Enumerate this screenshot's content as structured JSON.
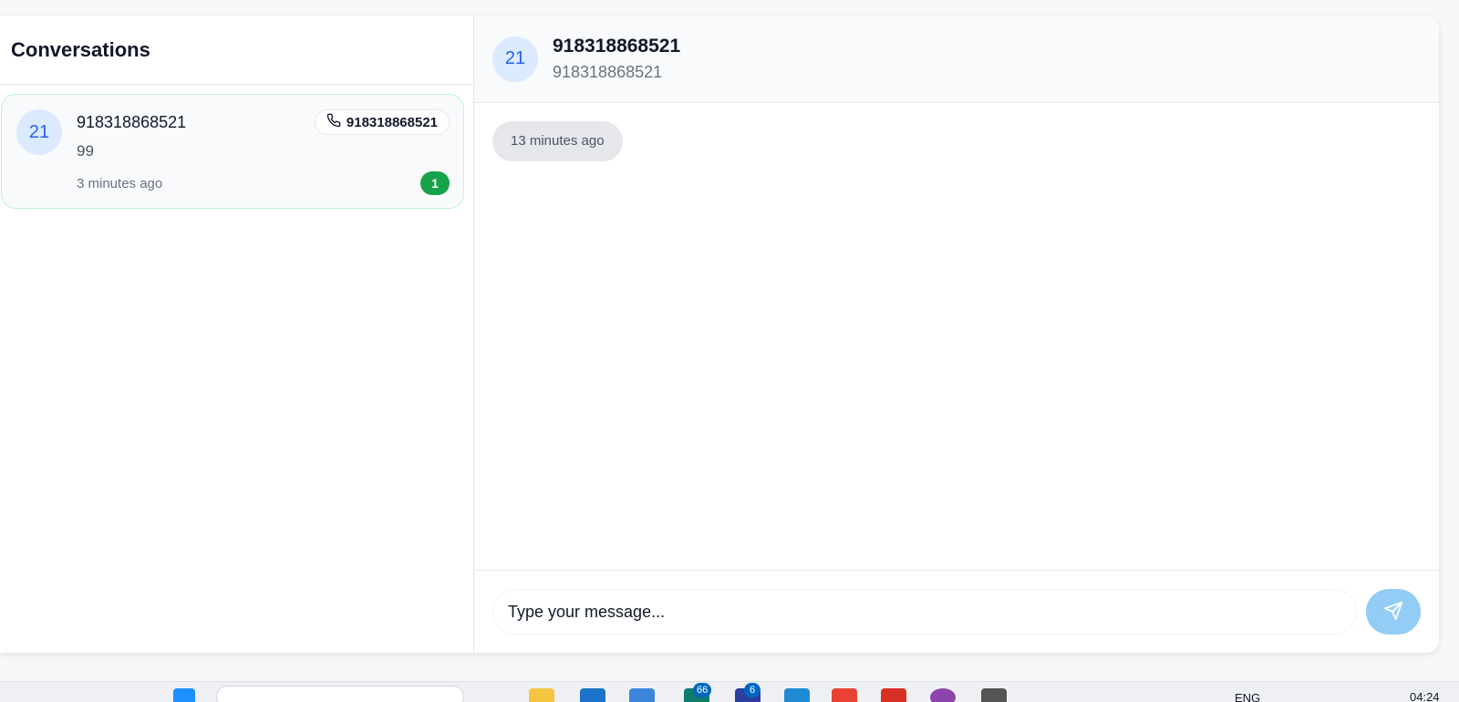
{
  "sidebar": {
    "title": "Conversations",
    "conversations": [
      {
        "avatar_text": "21",
        "name": "918318868521",
        "preview": "99",
        "time": "3 minutes ago",
        "phone": "918318868521",
        "unread_count": "1"
      }
    ]
  },
  "chat": {
    "avatar_text": "21",
    "title": "918318868521",
    "subtitle": "918318868521",
    "messages": [
      {
        "time": "13 minutes ago"
      }
    ],
    "composer": {
      "placeholder": "Type your message...",
      "send_icon": "send-icon"
    }
  },
  "taskbar": {
    "badges": [
      "66",
      "6"
    ],
    "language": "ENG",
    "clock": "04:24"
  },
  "colors": {
    "accent_green": "#16a34a",
    "avatar_bg": "#dbeafe",
    "avatar_text": "#2563eb",
    "send_button": "#93cdf5"
  }
}
